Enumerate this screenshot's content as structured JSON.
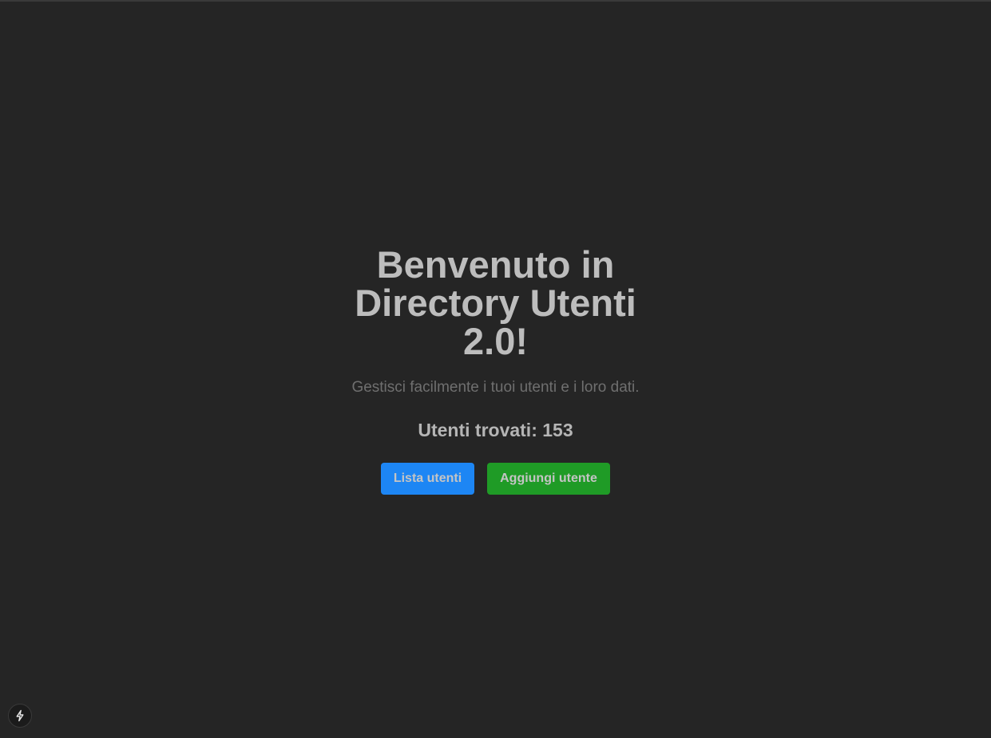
{
  "hero": {
    "title": "Benvenuto in Directory Utenti 2.0!",
    "subtitle": "Gestisci facilmente i tuoi utenti e i loro dati.",
    "user_count_text": "Utenti trovati: 153"
  },
  "actions": {
    "list_users_label": "Lista utenti",
    "add_user_label": "Aggiungi utente"
  },
  "colors": {
    "background": "#252525",
    "primary_button": "#1d86f4",
    "success_button": "#1f9b26",
    "text": "#bdbdbd"
  },
  "dev_indicator": {
    "icon": "lightning-bolt-icon"
  }
}
